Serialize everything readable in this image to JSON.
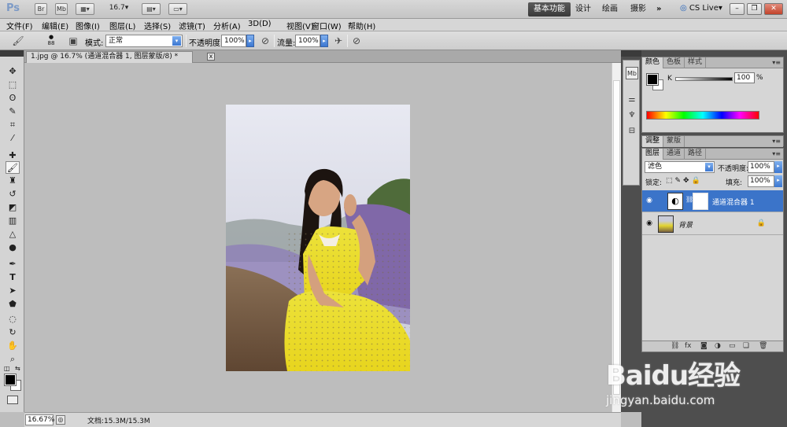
{
  "appbar": {
    "logo": "Ps",
    "br": "Br",
    "mb": "Mb",
    "zoom": "16.7",
    "workspaces": [
      "基本功能",
      "设计",
      "绘画",
      "摄影"
    ],
    "more": "»",
    "cslive": "CS Live",
    "window_controls": [
      "–",
      "❐",
      "✕"
    ]
  },
  "menu": [
    "文件(F)",
    "编辑(E)",
    "图像(I)",
    "图层(L)",
    "选择(S)",
    "滤镜(T)",
    "分析(A)",
    "3D(D)",
    "视图(V)",
    "窗口(W)",
    "帮助(H)"
  ],
  "options": {
    "brush_size": "88",
    "mode_label": "模式:",
    "mode_value": "正常",
    "opacity_label": "不透明度:",
    "opacity_value": "100%",
    "flow_label": "流量:",
    "flow_value": "100%"
  },
  "document": {
    "tab_title": "1.jpg @ 16.7% (通道混合器 1, 图层蒙版/8) *",
    "close": "x",
    "zoom": "16.67%",
    "info": "文档:15.3M/15.3M"
  },
  "color_panel": {
    "tabs": [
      "颜色",
      "色板",
      "样式"
    ],
    "channel": "K",
    "value": "100",
    "unit": "%"
  },
  "adjust_panel": {
    "tabs": [
      "调整",
      "蒙版"
    ]
  },
  "layers_panel": {
    "tabs": [
      "图层",
      "通道",
      "路径"
    ],
    "blend_mode": "滤色",
    "opacity_label": "不透明度:",
    "opacity_value": "100%",
    "lock_label": "锁定:",
    "fill_label": "填充:",
    "fill_value": "100%",
    "layers": [
      {
        "name": "通道混合器 1",
        "selected": true
      },
      {
        "name": "背景",
        "selected": false
      }
    ]
  },
  "watermark": {
    "logo": "Baidu经验",
    "url": "jingyan.baidu.com"
  },
  "colors": {
    "accent": "#3b74c9",
    "canvas": "#bdbdbd"
  }
}
